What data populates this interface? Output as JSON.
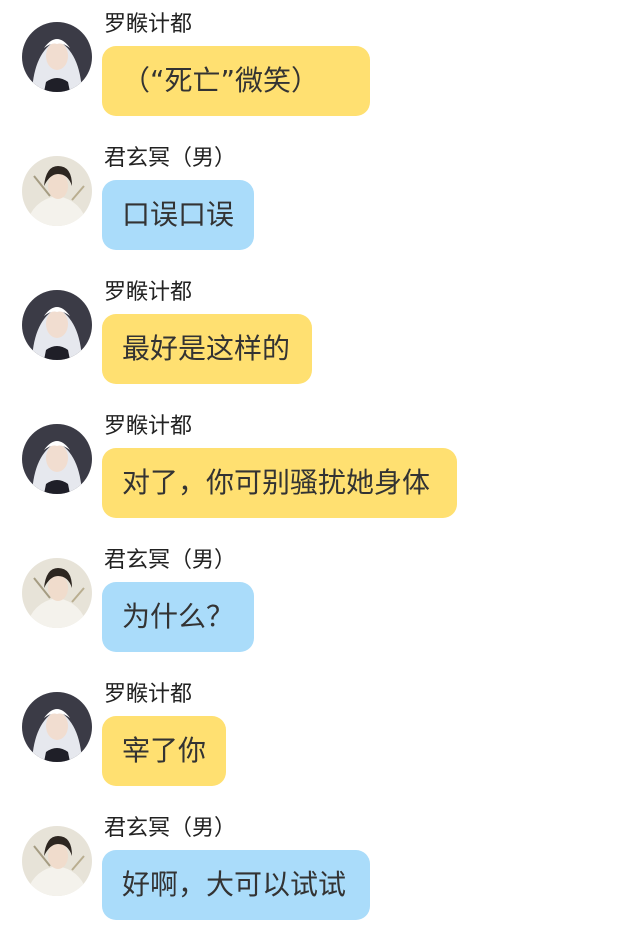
{
  "colors": {
    "yellow_bubble": "#ffe071",
    "blue_bubble": "#aadcfa"
  },
  "icons": {
    "avatar_a": "white-haired-character-avatar-icon",
    "avatar_b": "dark-haired-character-avatar-icon"
  },
  "messages": [
    {
      "speaker": "罗睺计都",
      "text": "（“死亡”微笑）"
    },
    {
      "speaker": "君玄冥（男）",
      "text": "口误口误"
    },
    {
      "speaker": "罗睺计都",
      "text": "最好是这样的"
    },
    {
      "speaker": "罗睺计都",
      "text": "对了，你可别骚扰她身体"
    },
    {
      "speaker": "君玄冥（男）",
      "text": "为什么？"
    },
    {
      "speaker": "罗睺计都",
      "text": "宰了你"
    },
    {
      "speaker": "君玄冥（男）",
      "text": "好啊，大可以试试"
    }
  ]
}
